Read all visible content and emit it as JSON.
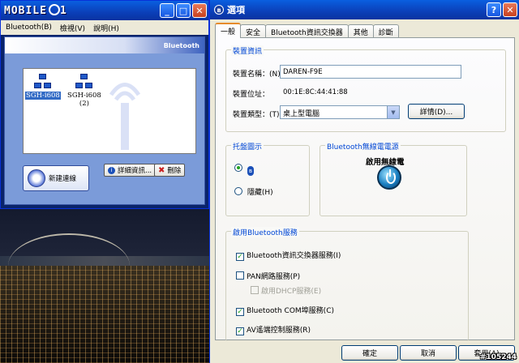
{
  "left_window": {
    "title": "MOBILE01",
    "menu": [
      "Bluetooth(B)",
      "檢視(V)",
      "說明(H)"
    ],
    "brand": "Bluetooth",
    "devices": [
      {
        "name": "SGH-i608",
        "sub": "",
        "selected": true
      },
      {
        "name": "SGH-i608",
        "sub": "(2)",
        "selected": false
      }
    ],
    "new_conn_label": "新建連線",
    "details_label": "詳細資訊...",
    "delete_label": "刪除"
  },
  "dialog": {
    "title": "選項",
    "tabs": [
      "一般",
      "安全",
      "Bluetooth資訊交換器",
      "其他",
      "診斷"
    ],
    "active_tab": 0,
    "device_info": {
      "legend": "裝置資訊",
      "name_label": "裝置名稱：(N)",
      "name_value": "DAREN-F9E",
      "address_label": "裝置位址：",
      "address_value": "00:1E:8C:44:41:88",
      "type_label": "裝置類型：(T)",
      "type_value": "桌上型電腦",
      "details_button": "詳情(D)..."
    },
    "tray": {
      "legend": "托盤圖示",
      "show_selected": true,
      "hide_label": "隱藏(H)"
    },
    "radio": {
      "legend": "Bluetooth無線電電源",
      "status": "啟用無線電"
    },
    "services": {
      "legend": "啟用Bluetooth服務",
      "items": [
        {
          "label": "Bluetooth資訊交換器服務(I)",
          "checked": true,
          "disabled": false
        },
        {
          "label": "PAN網路服務(P)",
          "checked": false,
          "disabled": false
        },
        {
          "label": "啟用DHCP服務(E)",
          "checked": false,
          "disabled": true
        },
        {
          "label": "Bluetooth COM埠服務(C)",
          "checked": true,
          "disabled": false
        },
        {
          "label": "AV遙端控制服務(R)",
          "checked": true,
          "disabled": false
        }
      ]
    },
    "ok_label": "確定",
    "cancel_label": "取消",
    "apply_label": "套用(A)"
  },
  "watermark": "#105244",
  "colors": {
    "titlebar": "#0b3fb8",
    "legend": "#0046d5",
    "accent_tab": "#e68b2c"
  }
}
